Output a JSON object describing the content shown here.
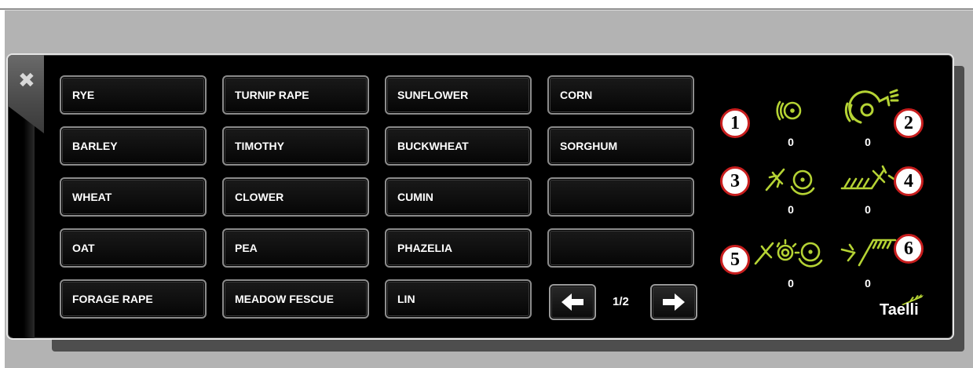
{
  "close_label": "✖",
  "crops": [
    [
      "RYE",
      "TURNIP RAPE",
      "SUNFLOWER",
      "CORN"
    ],
    [
      "BARLEY",
      "TIMOTHY",
      "BUCKWHEAT",
      "SORGHUM"
    ],
    [
      "WHEAT",
      "CLOWER",
      "CUMIN",
      ""
    ],
    [
      "OAT",
      "PEA",
      "PHAZELIA",
      ""
    ],
    [
      "FORAGE RAPE",
      "MEADOW FESCUE",
      "LIN"
    ]
  ],
  "pagination": {
    "page": "1/2",
    "prev_icon": "arrow-left-icon",
    "next_icon": "arrow-right-icon"
  },
  "sensors": [
    {
      "number": "1",
      "count": "0",
      "icon": "rotation-sensor-icon"
    },
    {
      "number": "2",
      "count": "0",
      "icon": "blower-sensor-icon"
    },
    {
      "number": "3",
      "count": "0",
      "icon": "rotor-pressure-sensor-icon"
    },
    {
      "number": "4",
      "count": "0",
      "icon": "ground-pressure-sensor-icon"
    },
    {
      "number": "5",
      "count": "0",
      "icon": "double-rotor-sensor-icon"
    },
    {
      "number": "6",
      "count": "0",
      "icon": "ground-slope-sensor-icon"
    }
  ],
  "brand": "Taelli",
  "colors": {
    "icon_green": "#b5d334",
    "badge_border": "#c81e1e",
    "panel_bg": "#000000"
  }
}
